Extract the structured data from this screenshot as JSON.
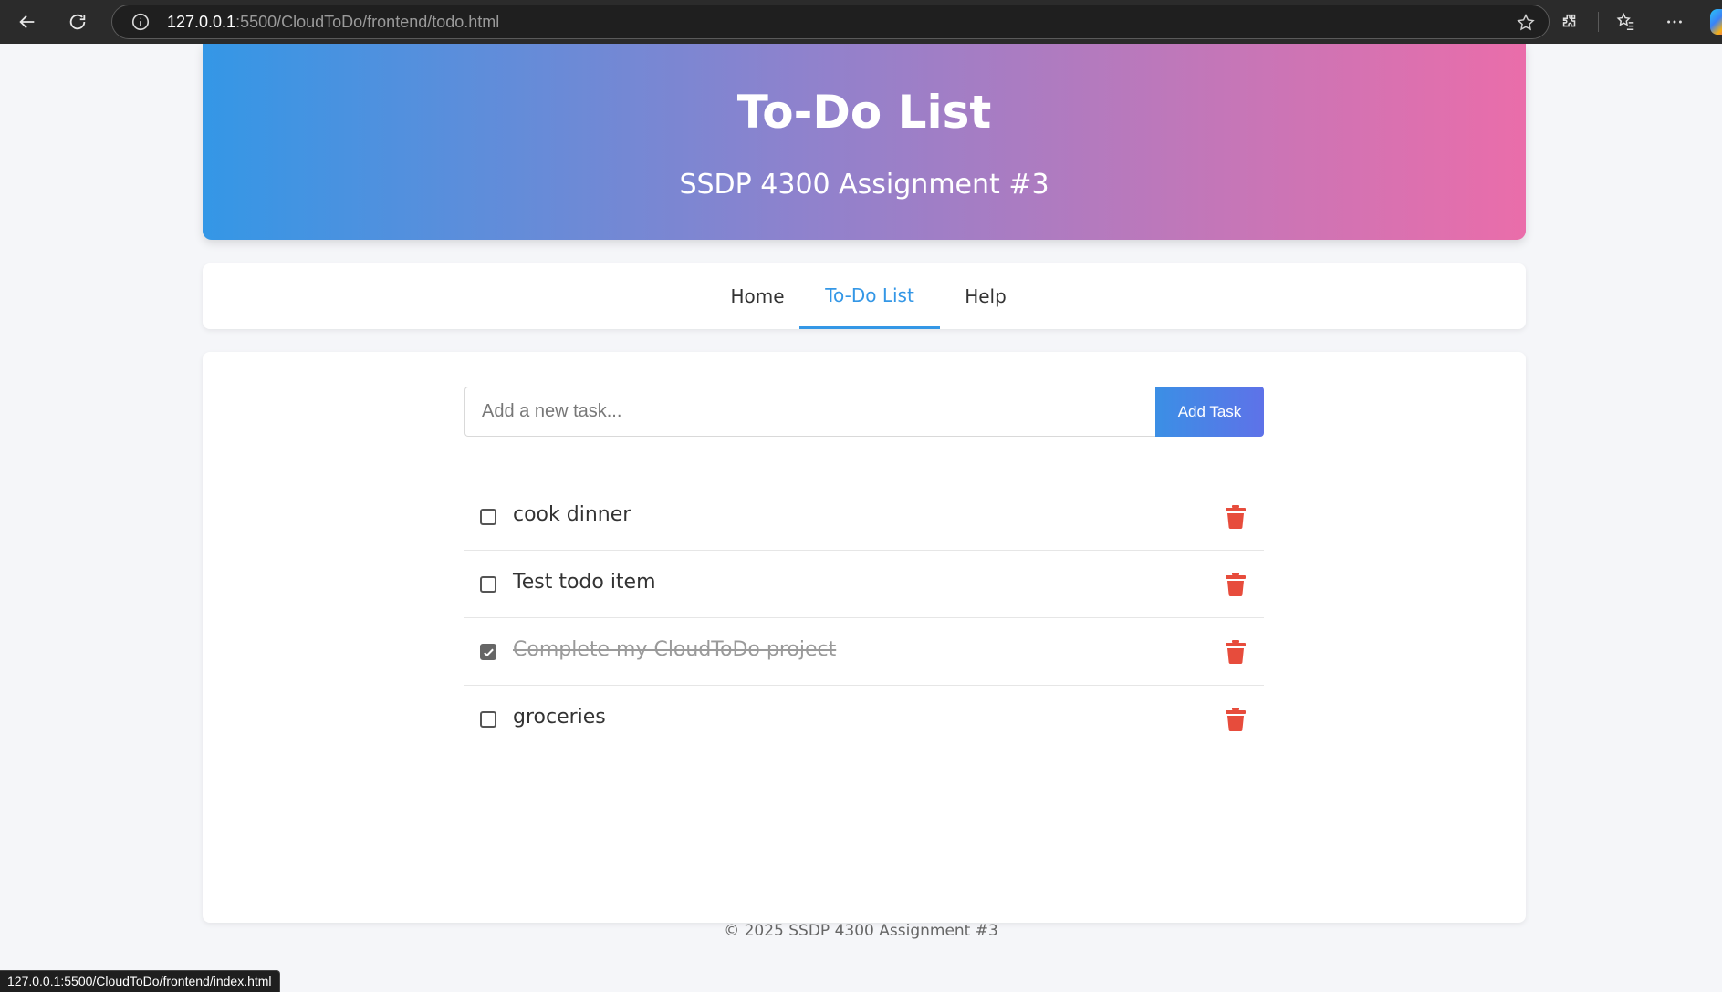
{
  "browser": {
    "url_host": "127.0.0.1",
    "url_rest": ":5500/CloudToDo/frontend/todo.html",
    "status_url": "127.0.0.1:5500/CloudToDo/frontend/index.html"
  },
  "header": {
    "title": "To-Do List",
    "subtitle": "SSDP 4300 Assignment #3"
  },
  "nav": {
    "tabs": [
      {
        "label": "Home",
        "active": false
      },
      {
        "label": "To-Do List",
        "active": true
      },
      {
        "label": "Help",
        "active": false
      }
    ]
  },
  "form": {
    "placeholder": "Add a new task...",
    "value": "",
    "button_label": "Add Task"
  },
  "todos": [
    {
      "text": "cook dinner",
      "done": false
    },
    {
      "text": "Test todo item",
      "done": false
    },
    {
      "text": "Complete my CloudToDo project",
      "done": true
    },
    {
      "text": "groceries",
      "done": false
    }
  ],
  "footer": {
    "text": "© 2025 SSDP 4300 Assignment #3"
  },
  "colors": {
    "accent": "#3497e6",
    "delete": "#e74c3c",
    "header_gradient_start": "#3497e6",
    "header_gradient_end": "#ea6daa"
  },
  "icons": {
    "back": "arrow-left-icon",
    "refresh": "refresh-icon",
    "info": "info-icon",
    "favorite": "star-icon",
    "extensions": "puzzle-icon",
    "favorites": "favorites-list-icon",
    "menu": "more-icon",
    "delete": "trash-icon",
    "checked": "checkmark-icon"
  }
}
